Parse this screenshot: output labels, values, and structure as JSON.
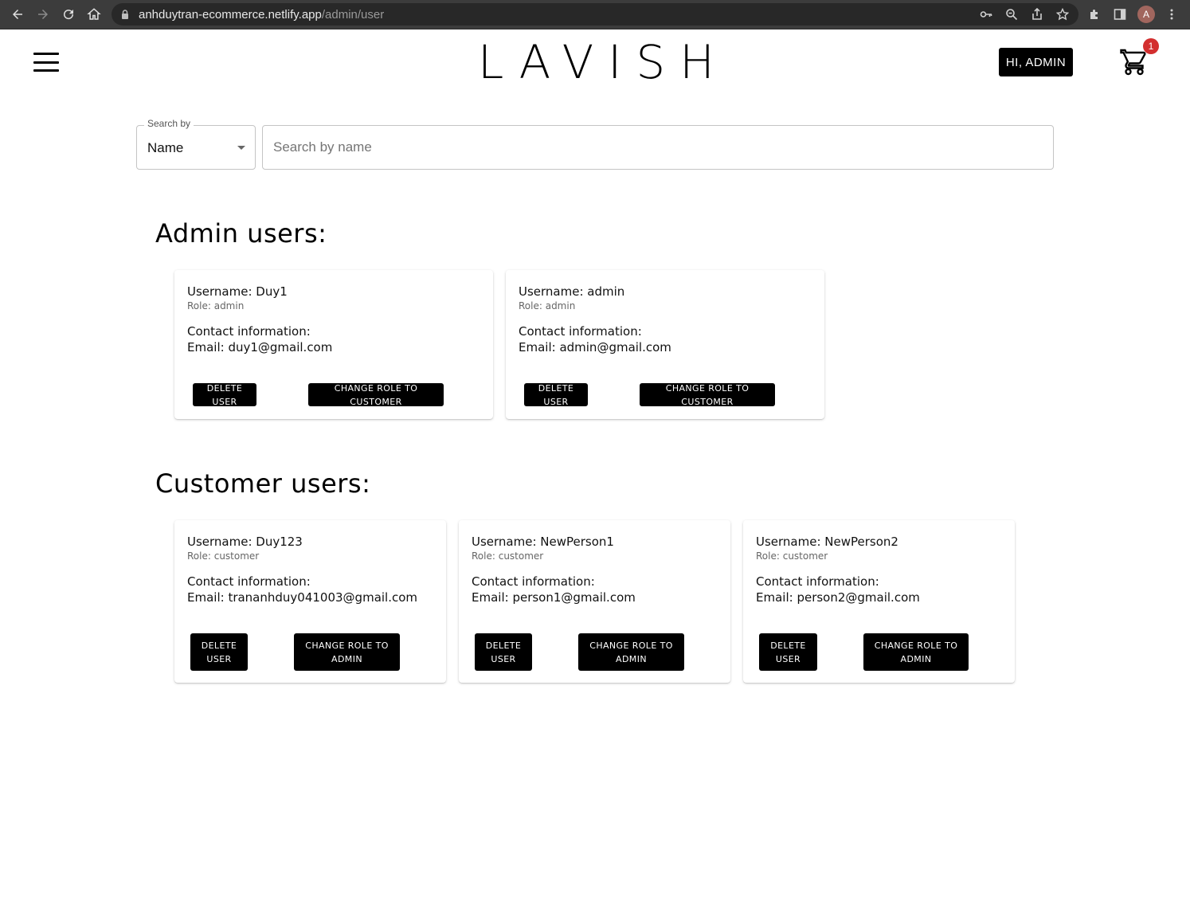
{
  "browser": {
    "url_domain": "anhduytran-ecommerce.netlify.app",
    "url_path": "/admin/user",
    "profile_initial": "A"
  },
  "header": {
    "logo": "LAVISH",
    "greeting": "HI, ADMIN",
    "cart_count": "1"
  },
  "search": {
    "by_label": "Search by",
    "by_value": "Name",
    "placeholder": "Search by name",
    "value": ""
  },
  "admin_section": {
    "heading": "Admin users:",
    "users": [
      {
        "username": "Username: Duy1",
        "role": "Role: admin",
        "contact_label": "Contact information:",
        "email": "Email: duy1@gmail.com",
        "delete_label": "DELETE USER",
        "change_label": "CHANGE ROLE TO CUSTOMER"
      },
      {
        "username": "Username: admin",
        "role": "Role: admin",
        "contact_label": "Contact information:",
        "email": "Email: admin@gmail.com",
        "delete_label": "DELETE USER",
        "change_label": "CHANGE ROLE TO CUSTOMER"
      }
    ]
  },
  "customer_section": {
    "heading": "Customer users:",
    "users": [
      {
        "username": "Username: Duy123",
        "role": "Role: customer",
        "contact_label": "Contact information:",
        "email": "Email: trananhduy041003@gmail.com",
        "delete_label": "DELETE USER",
        "change_label": "CHANGE ROLE TO ADMIN"
      },
      {
        "username": "Username: NewPerson1",
        "role": "Role: customer",
        "contact_label": "Contact information:",
        "email": "Email: person1@gmail.com",
        "delete_label": "DELETE USER",
        "change_label": "CHANGE ROLE TO ADMIN"
      },
      {
        "username": "Username: NewPerson2",
        "role": "Role: customer",
        "contact_label": "Contact information:",
        "email": "Email: person2@gmail.com",
        "delete_label": "DELETE USER",
        "change_label": "CHANGE ROLE TO ADMIN"
      }
    ]
  },
  "colors": {
    "chrome_bg": "#3c3c3c",
    "primary_button": "#000000",
    "badge": "#d32f2f"
  }
}
